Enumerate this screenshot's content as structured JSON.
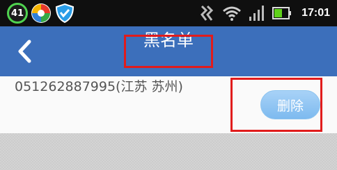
{
  "status_bar": {
    "badge_number": "41",
    "time": "17:01",
    "battery_color": "#5fd11a",
    "icons": [
      "badge-41-icon",
      "colorful-app-icon",
      "shield-icon",
      "nfc-icon",
      "wifi-icon",
      "signal-icon",
      "battery-icon"
    ]
  },
  "header": {
    "back_icon": "chevron-left-icon",
    "title": "黑名单",
    "background": "#3c6fbb"
  },
  "list": {
    "items": [
      {
        "phone_text": "051262887995(江苏 苏州)",
        "delete_label": "删除"
      }
    ]
  },
  "annotation_color": "#e11c1c"
}
